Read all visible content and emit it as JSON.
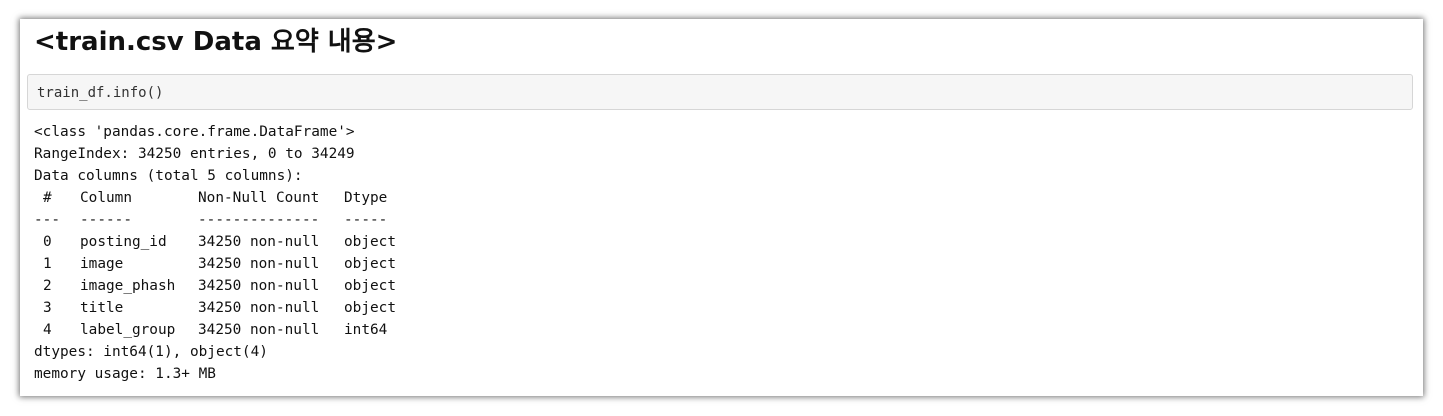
{
  "heading": "<train.csv Data 요약 내용>",
  "code": "train_df.info()",
  "output": {
    "class_line": "<class 'pandas.core.frame.DataFrame'>",
    "range_line": "RangeIndex: 34250 entries, 0 to 34249",
    "columns_line": "Data columns (total 5 columns):",
    "headers": {
      "idx": "#",
      "column": "Column",
      "count": "Non-Null Count",
      "dtype": "Dtype"
    },
    "separators": {
      "idx": "---",
      "column": "------",
      "count": "--------------",
      "dtype": "-----"
    },
    "rows": [
      {
        "idx": "0",
        "column": "posting_id",
        "count": "34250 non-null",
        "dtype": "object"
      },
      {
        "idx": "1",
        "column": "image",
        "count": "34250 non-null",
        "dtype": "object"
      },
      {
        "idx": "2",
        "column": "image_phash",
        "count": "34250 non-null",
        "dtype": "object"
      },
      {
        "idx": "3",
        "column": "title",
        "count": "34250 non-null",
        "dtype": "object"
      },
      {
        "idx": "4",
        "column": "label_group",
        "count": "34250 non-null",
        "dtype": "int64"
      }
    ],
    "dtypes_line": "dtypes: int64(1), object(4)",
    "memory_line": "memory usage: 1.3+ MB"
  }
}
